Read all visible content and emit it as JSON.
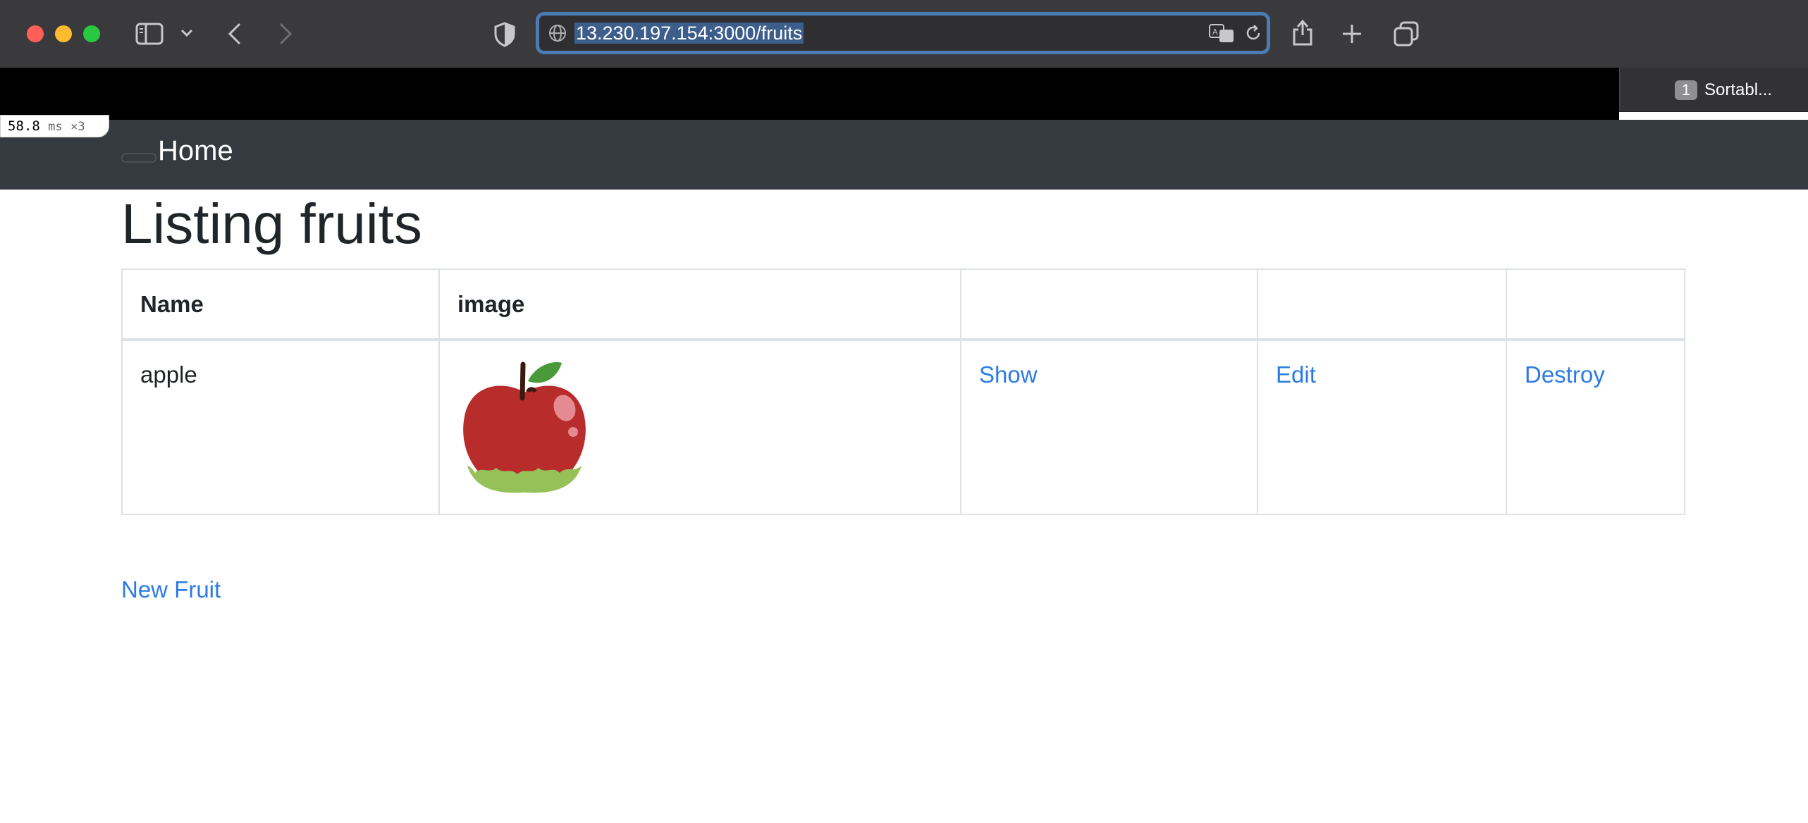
{
  "browser": {
    "url": "13.230.197.154:3000/fruits",
    "tab": {
      "badge": "1",
      "title": "Sortabl..."
    },
    "perf": {
      "value": "58.8",
      "unit": "ms",
      "count": "×3"
    }
  },
  "nav": {
    "home_label": "Home"
  },
  "page": {
    "title": "Listing fruits",
    "table": {
      "headers": [
        "Name",
        "image",
        "",
        "",
        ""
      ],
      "rows": [
        {
          "name": "apple",
          "image": "apple-image",
          "show": "Show",
          "edit": "Edit",
          "destroy": "Destroy"
        }
      ]
    },
    "new_link": "New Fruit"
  },
  "colors": {
    "link": "#2c7be5",
    "navbar": "#343a40",
    "text": "#212529"
  }
}
